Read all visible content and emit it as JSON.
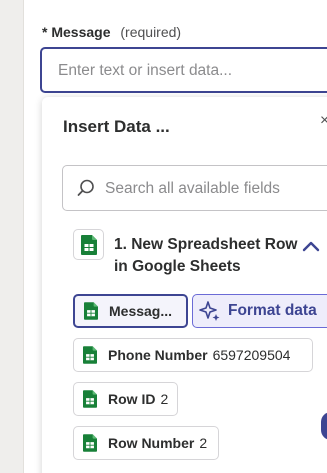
{
  "field": {
    "required_marker": "*",
    "label": "Message",
    "required_text": "(required)",
    "placeholder": "Enter text or insert data..."
  },
  "insert_data": {
    "title": "Insert Data ...",
    "search_placeholder": "Search all available fields"
  },
  "step": {
    "title": "1. New Spreadsheet Row in Google Sheets",
    "icon": "google-sheets-icon"
  },
  "fields": [
    {
      "key": "Messag...",
      "value": "",
      "selected": true
    },
    {
      "key": "Phone Number",
      "value": "6597209504",
      "selected": false
    },
    {
      "key": "Row ID",
      "value": "2",
      "selected": false
    },
    {
      "key": "Row Number",
      "value": "2",
      "selected": false
    }
  ],
  "format_button": {
    "label": "Format data",
    "icon": "sparkle-icon"
  },
  "colors": {
    "accent": "#3d4592",
    "sheets_green": "#188038",
    "format_bg": "#eeedfb"
  }
}
